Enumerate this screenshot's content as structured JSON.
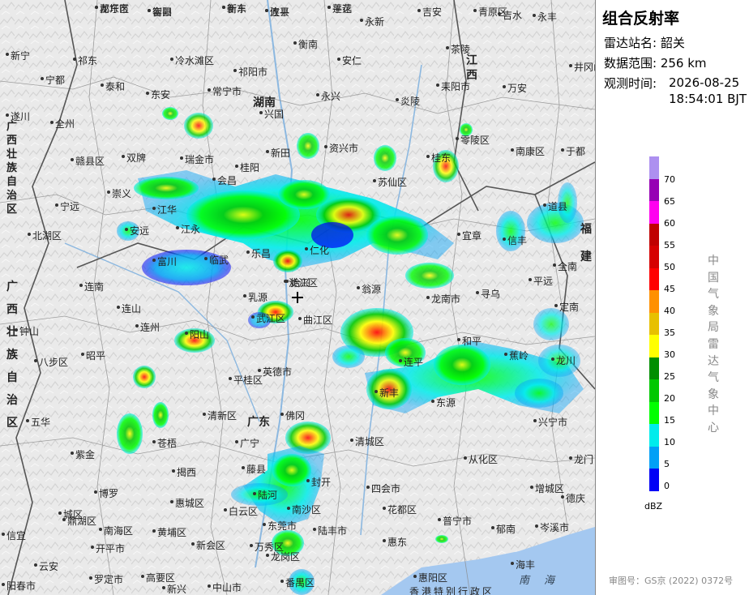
{
  "panel": {
    "title": "组合反射率",
    "station_label": "雷达站名:",
    "station_value": "韶关",
    "range_label": "数据范围:",
    "range_value": "256 km",
    "time_label": "观测时间:",
    "time_date": "2026-08-25",
    "time_clock": "18:54:01 BJT",
    "legend_unit": "dBZ",
    "legend_levels": [
      "70",
      "65",
      "60",
      "55",
      "50",
      "45",
      "40",
      "35",
      "30",
      "25",
      "20",
      "15",
      "10",
      "5",
      "0"
    ],
    "legend_colors": [
      "#ad90f0",
      "#9600b4",
      "#ff00f0",
      "#c00000",
      "#d60000",
      "#ff0000",
      "#ff9000",
      "#e7c000",
      "#ffff00",
      "#008e00",
      "#00c800",
      "#01ff00",
      "#00ecec",
      "#01a0f6",
      "#0000f6"
    ],
    "organization": "中国气象局雷达气象中心",
    "review_number": "审图号：GS京 (2022) 0372号"
  },
  "map": {
    "provinces": [
      "湖南",
      "江西",
      "广东",
      "广西壮族自治区",
      "福建",
      "广西壮族自治区"
    ],
    "sea": "南海",
    "hongkong": "香港特别行政区",
    "cities": [
      "郡东市",
      "衡阳",
      "衡东",
      "攸县",
      "莲花",
      "永新",
      "吉安",
      "青原区",
      "吉水",
      "永丰",
      "新宁",
      "祁东",
      "冷水滩区",
      "衡南",
      "茶陵",
      "泰和",
      "祁阳市",
      "安仁",
      "井冈山市",
      "宁都",
      "东安",
      "常宁市",
      "耒阳市",
      "万安",
      "兴国",
      "永兴",
      "炎陵",
      "遂川",
      "全州",
      "零陵区",
      "赣县区",
      "双牌",
      "新田",
      "资兴市",
      "桂东",
      "南康区",
      "于都",
      "瑞金市",
      "桂阳",
      "苏仙区",
      "崇义",
      "宁远",
      "道县",
      "会昌",
      "北湖区",
      "江永",
      "临武",
      "宜章",
      "信丰",
      "安远",
      "富川",
      "江华",
      "乐昌",
      "仁化",
      "始兴",
      "全南",
      "龙南市",
      "寻乌",
      "平远",
      "定南",
      "钟山",
      "连山",
      "乳源",
      "浈江区",
      "翁源",
      "连南",
      "武江区",
      "曲江区",
      "连州",
      "阳山",
      "英德市",
      "新丰",
      "和平",
      "八步区",
      "昭平",
      "平桂区",
      "清新区",
      "佛冈",
      "连平",
      "东源",
      "蕉岭",
      "龙川",
      "兴宁市",
      "五华",
      "苍梧",
      "广宁",
      "清城区",
      "从化区",
      "龙门",
      "紫金",
      "揭西",
      "藤县",
      "封开",
      "四会市",
      "花都区",
      "增城区",
      "博罗",
      "惠城区",
      "陆河",
      "德庆",
      "鼎湖区",
      "白云区",
      "陆丰市",
      "普宁市",
      "郁南",
      "南海区",
      "黄埔区",
      "东莞市",
      "惠东",
      "岑溪市",
      "云安",
      "高要区",
      "番禺区",
      "惠阳区",
      "海丰",
      "罗定市",
      "新兴",
      "中山市",
      "龙岗区",
      "城区",
      "信宜",
      "阳春市",
      "开平市",
      "新会区",
      "南沙区",
      "万秀区",
      "龙圩区",
      "容县",
      "新丰",
      "连平",
      "平远"
    ]
  }
}
